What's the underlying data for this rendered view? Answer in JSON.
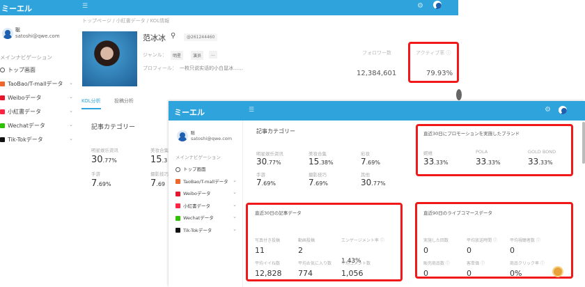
{
  "back": {
    "logo": "ミーエル",
    "user": {
      "name": "聡",
      "email": "satoshi@qwe.com"
    },
    "nav_label": "メインナビゲーション",
    "nav": [
      {
        "label": "トップ画面",
        "icon": "clock-icon"
      },
      {
        "label": "TaoBao/T-mallデータ",
        "icon": "taobao-icon"
      },
      {
        "label": "Weiboデータ",
        "icon": "weibo-icon"
      },
      {
        "label": "小紅書データ",
        "icon": "xiaohongshu-icon"
      },
      {
        "label": "Wechatデータ",
        "icon": "wechat-icon"
      },
      {
        "label": "Tik-Tokデータ",
        "icon": "tiktok-icon"
      }
    ],
    "breadcrumb": [
      "トップページ",
      "小紅書データ",
      "KOL情報"
    ],
    "profile": {
      "name": "范冰冰",
      "id": "@261244460",
      "genre_label": "ジャンル：",
      "genres": [
        "明星",
        "演员",
        "..."
      ],
      "profile_label": "プロフィール：",
      "profile_text": "一枚只说实话的小白鼠冰……"
    },
    "followers_label": "フォロワー数",
    "followers": "12,384,601",
    "active_label": "アクティブ率",
    "active": "79.93%",
    "tabs": [
      "KOL分析",
      "投稿分析"
    ],
    "card_title": "記事カテゴリー",
    "cats": [
      {
        "label": "明星娱乐资讯",
        "int": "30",
        "dec": ".77%"
      },
      {
        "label": "美妆合集",
        "int": "15",
        "dec": ".3"
      },
      {
        "label": "手游",
        "int": "7",
        "dec": ".69%"
      },
      {
        "label": "摄影技巧",
        "int": "7",
        "dec": ".69"
      }
    ]
  },
  "front": {
    "logo": "ミーエル",
    "user": {
      "name": "聡",
      "email": "satoshi@qwe.com"
    },
    "nav_label": "メインナビゲーション",
    "nav": [
      "トップ画面",
      "TaoBao/T-mallデータ",
      "Weiboデータ",
      "小紅書データ",
      "Wechatデータ",
      "Tik-Tokデータ"
    ],
    "cat_title": "記事カテゴリー",
    "cats": [
      {
        "label": "明星娱乐资讯",
        "int": "30",
        "dec": ".77%"
      },
      {
        "label": "美妆合集",
        "int": "15",
        "dec": ".38%"
      },
      {
        "label": "彩妆",
        "int": "7",
        "dec": ".69%"
      },
      {
        "label": "手游",
        "int": "7",
        "dec": ".69%"
      },
      {
        "label": "摄影技巧",
        "int": "7",
        "dec": ".69%"
      },
      {
        "label": "其他",
        "int": "30",
        "dec": ".77%"
      }
    ],
    "brand_title": "直近30日にプロモーションを実施したブランド",
    "brands": [
      {
        "label": "妮维",
        "int": "33",
        "dec": ".33%"
      },
      {
        "label": "POLA",
        "int": "33",
        "dec": ".33%"
      },
      {
        "label": "GOLD BOND",
        "int": "33",
        "dec": ".33%"
      }
    ],
    "article_title": "直近30日の記事データ",
    "articles": [
      {
        "label": "写真付き投稿",
        "value": "11"
      },
      {
        "label": "動画投稿",
        "value": "2"
      },
      {
        "label": "エンゲージメント率",
        "value": "1.43%"
      },
      {
        "label": "平均イイね数",
        "value": "12,828"
      },
      {
        "label": "平均お気に入り数",
        "value": "774"
      },
      {
        "label": "平均コメント数",
        "value": "1,056"
      }
    ],
    "live_title": "直近90日のライブコマースデータ",
    "live": [
      {
        "label": "実施した回数",
        "value": "0"
      },
      {
        "label": "平均放送時間",
        "value": "0"
      },
      {
        "label": "平均視聴者数",
        "value": "0"
      },
      {
        "label": "販売商品数",
        "value": "0"
      },
      {
        "label": "客単価",
        "value": "0"
      },
      {
        "label": "商品クリック率",
        "value": "0%"
      }
    ]
  },
  "colors": {
    "header": "#2ea3dc",
    "highlight": "#f01818"
  }
}
